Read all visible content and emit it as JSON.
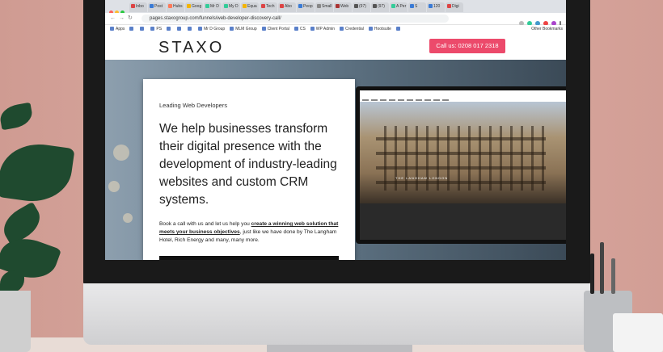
{
  "browser": {
    "url": "pages.staxogroup.com/funnels/web-developer-discovery-call/",
    "tabs": [
      "Inbo",
      "Post",
      "Hubs",
      "Goog",
      "Mr D",
      "My D",
      "Equa",
      "Tech",
      "Abo",
      "Peop",
      "Small",
      "Web",
      "(97)",
      "(97)",
      "A Per",
      "S",
      "120",
      "Digi"
    ],
    "bookmarks": [
      "Apps",
      "",
      "",
      "PS",
      "",
      "",
      "",
      "Mr D Group",
      "MLM Group",
      "Client Portal",
      "CS",
      "WP Admin",
      "Credential",
      "Hootsuite",
      ""
    ],
    "other_bookmarks": "Other Bookmarks",
    "colors": {
      "close": "#ff5f57",
      "minimize": "#febc2e",
      "maximize": "#28c840"
    }
  },
  "site": {
    "logo": "STAXO",
    "call_button": "Call us: 0208 017 2318",
    "accent": "#ec4a6b"
  },
  "hero": {
    "kicker": "Leading Web Developers",
    "headline": "We help businesses transform their digital presence with the development of industry-leading websites and custom CRM systems.",
    "body_prefix": "Book a call with us and let us help you ",
    "body_link": "create a winning web solution that meets your business objectives",
    "body_suffix": ", just like we have done by The Langham Hotel, Rich Energy and many, many more."
  },
  "laptop": {
    "caption": "THE LANGHAM LONDON"
  }
}
